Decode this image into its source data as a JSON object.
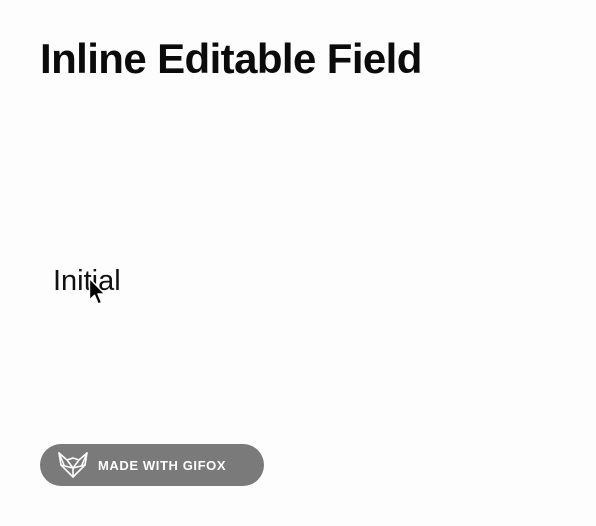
{
  "page": {
    "title": "Inline Editable Field"
  },
  "editable_field": {
    "value": "Initial"
  },
  "badge": {
    "label": "MADE WITH GIFOX",
    "icon": "fox-icon",
    "background": "#7a7a7a"
  },
  "cursor": {
    "icon": "mouse-pointer-icon"
  }
}
